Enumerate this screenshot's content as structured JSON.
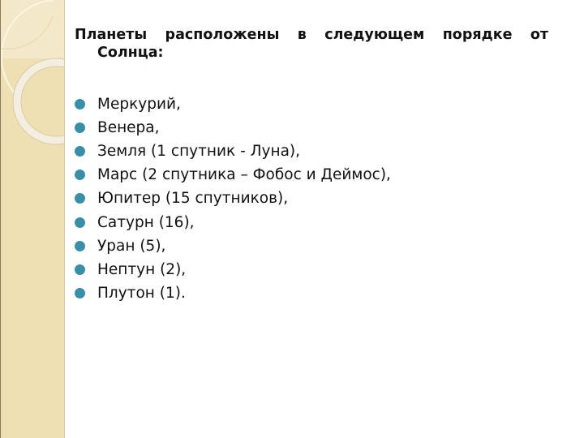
{
  "slide": {
    "title_line1": "Планеты расположены в следующем порядке от",
    "title_line2": "Солнца:",
    "bullet_color": "#3a8fa8",
    "items": [
      "Меркурий,",
      "Венера,",
      "Земля (1 спутник - Луна),",
      "Марс (2 спутника – Фобос и Деймос),",
      "Юпитер (15 спутников),",
      "Сатурн (16),",
      "Уран (5),",
      "Нептун (2),",
      "Плутон (1)."
    ]
  }
}
